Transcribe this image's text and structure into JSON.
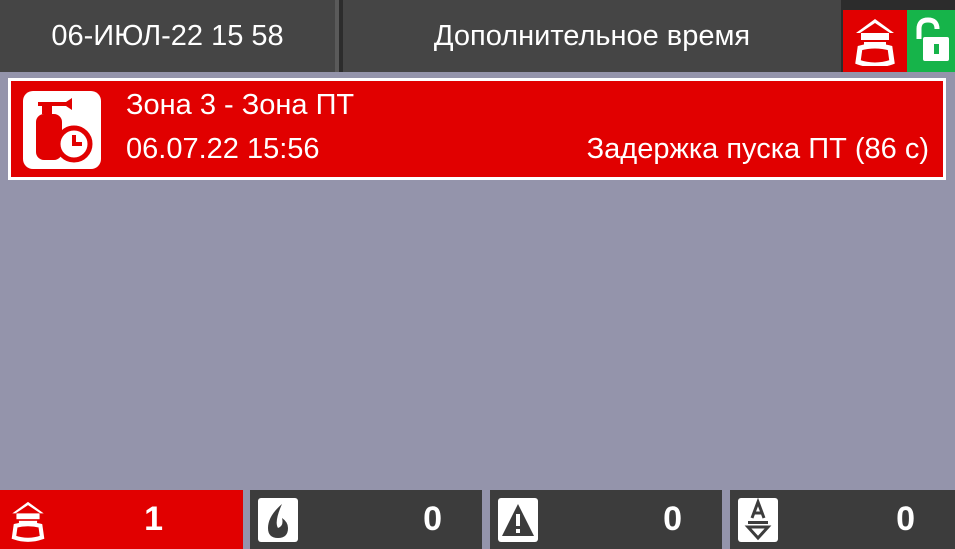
{
  "header": {
    "datetime": "06-ИЮЛ-22 15 58",
    "mode_title": "Дополнительное время",
    "fire_status_icon": "fire-alarm-icon",
    "lock_status_icon": "unlocked-padlock-icon"
  },
  "event": {
    "icon": "extinguisher-timer-icon",
    "zone": "Зона 3 - Зона ПТ",
    "time": "06.07.22 15:56",
    "status": "Задержка пуска ПТ (86 с)"
  },
  "counters": [
    {
      "icon": "fire-alarm-icon",
      "value": "1"
    },
    {
      "icon": "fire-flame-icon",
      "value": "0"
    },
    {
      "icon": "warning-triangle-icon",
      "value": "0"
    },
    {
      "icon": "disabled-arrow-icon",
      "value": "0"
    }
  ],
  "colors": {
    "alarm_red": "#e10000",
    "unlock_green": "#16b44a",
    "panel_dark": "#454545",
    "background": "#9494ab"
  }
}
